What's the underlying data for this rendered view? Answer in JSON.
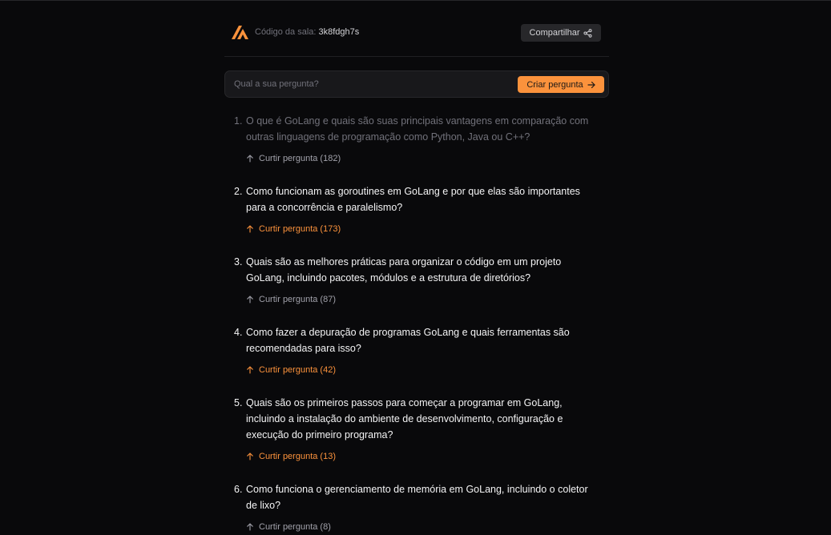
{
  "header": {
    "room_label": "Código da sala:",
    "room_code": "3k8fdgh7s",
    "share_label": "Compartilhar"
  },
  "ask": {
    "placeholder": "Qual a sua pergunta?",
    "value": "",
    "submit_label": "Criar pergunta"
  },
  "questions": [
    {
      "number": "1.",
      "text": "O que é GoLang e quais são suas principais vantagens em comparação com outras linguagens de programação como Python, Java ou C++?",
      "like_label": "Curtir pergunta (182)",
      "state": "answered"
    },
    {
      "number": "2.",
      "text": "Como funcionam as goroutines em GoLang e por que elas são importantes para a concorrência e paralelismo?",
      "like_label": "Curtir pergunta (173)",
      "state": "liked"
    },
    {
      "number": "3.",
      "text": "Quais são as melhores práticas para organizar o código em um projeto GoLang, incluindo pacotes, módulos e a estrutura de diretórios?",
      "like_label": "Curtir pergunta (87)",
      "state": "default"
    },
    {
      "number": "4.",
      "text": "Como fazer a depuração de programas GoLang e quais ferramentas são recomendadas para isso?",
      "like_label": "Curtir pergunta (42)",
      "state": "liked"
    },
    {
      "number": "5.",
      "text": "Quais são os primeiros passos para começar a programar em GoLang, incluindo a instalação do ambiente de desenvolvimento, configuração e execução do primeiro programa?",
      "like_label": "Curtir pergunta (13)",
      "state": "liked"
    },
    {
      "number": "6.",
      "text": "Como funciona o gerenciamento de memória em GoLang, incluindo o coletor de lixo?",
      "like_label": "Curtir pergunta (8)",
      "state": "default"
    }
  ],
  "icons": {
    "logo": "app-logo",
    "share": "share-icon",
    "submit": "arrow-right-icon",
    "like": "arrow-up-icon"
  },
  "colors": {
    "background": "#09090b",
    "accent": "#fb923c",
    "surface": "#18181b",
    "muted": "#71717a",
    "text": "#f4f4f5"
  }
}
